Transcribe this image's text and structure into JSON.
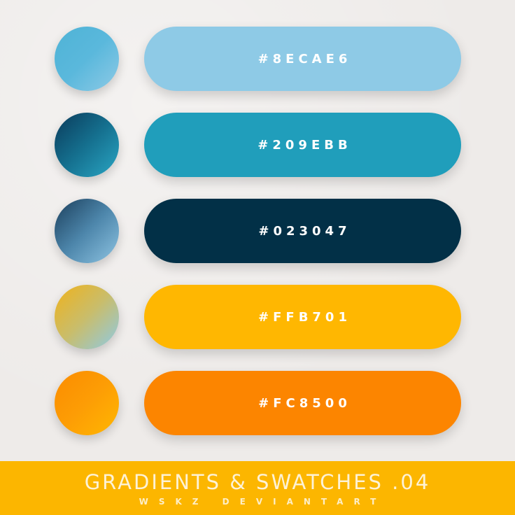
{
  "swatches": [
    {
      "hex": "#8ECAE6",
      "pill_color": "#8ecae6",
      "gradient": [
        "#4fb3d6",
        "#5ab8dc",
        "#8ecae6"
      ]
    },
    {
      "hex": "#209EBB",
      "pill_color": "#209ebb",
      "gradient": [
        "#0a3a5a",
        "#15708f",
        "#2aa6c4"
      ]
    },
    {
      "hex": "#023047",
      "pill_color": "#023047",
      "gradient": [
        "#1b3f5c",
        "#4d86ab",
        "#8ec4e2"
      ]
    },
    {
      "hex": "#FFB701",
      "pill_color": "#ffb701",
      "gradient": [
        "#f0b21a",
        "#c9bd6b",
        "#8ecae6"
      ]
    },
    {
      "hex": "#FC8500",
      "pill_color": "#fc8500",
      "gradient": [
        "#fb8c00",
        "#fd9d05",
        "#ffb701"
      ]
    }
  ],
  "footer": {
    "title": "GRADIENTS & SWATCHES .04",
    "subtitle": "WSKZ DEVIANTART",
    "background": "#fcb600"
  }
}
